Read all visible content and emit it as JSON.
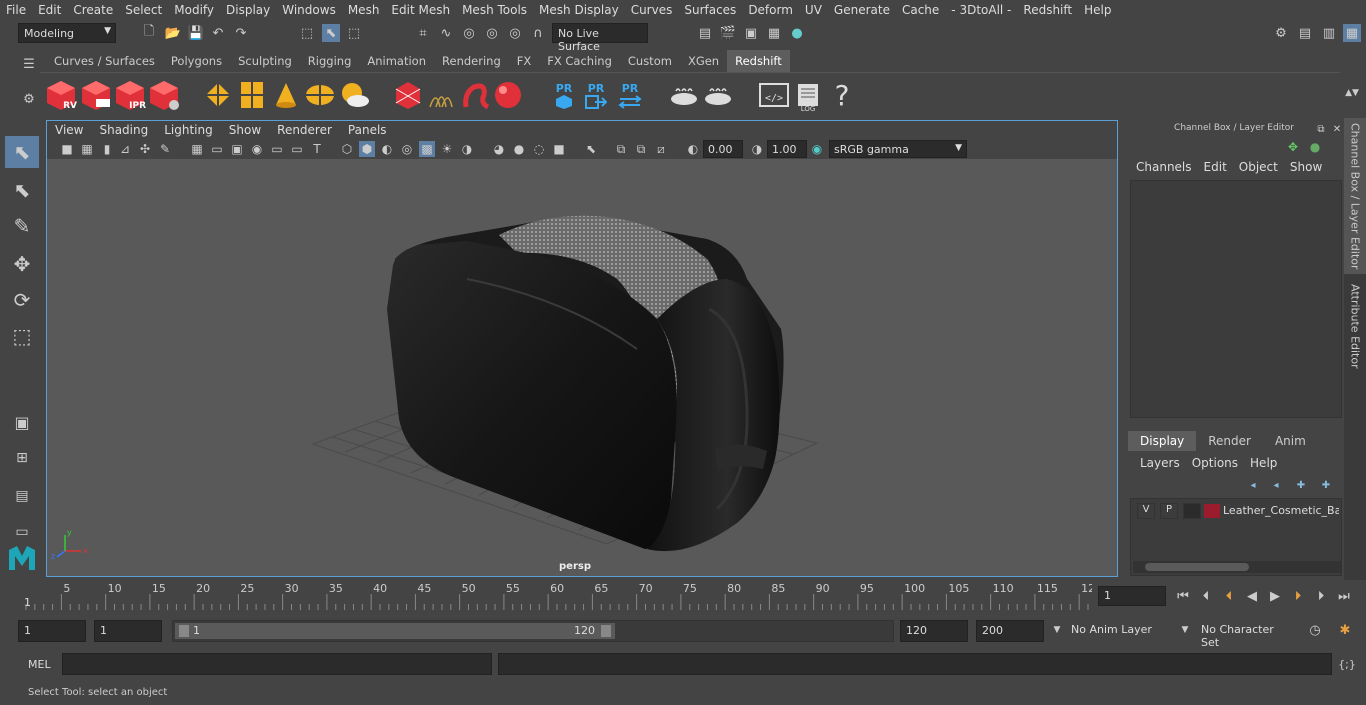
{
  "menubar": [
    "File",
    "Edit",
    "Create",
    "Select",
    "Modify",
    "Display",
    "Windows",
    "Mesh",
    "Edit Mesh",
    "Mesh Tools",
    "Mesh Display",
    "Curves",
    "Surfaces",
    "Deform",
    "UV",
    "Generate",
    "Cache",
    "- 3DtoAll -",
    "Redshift",
    "Help"
  ],
  "status": {
    "workspace": "Modeling",
    "live_surface": "No Live Surface"
  },
  "shelf": {
    "tabs": [
      "Curves / Surfaces",
      "Polygons",
      "Sculpting",
      "Rigging",
      "Animation",
      "Rendering",
      "FX",
      "FX Caching",
      "Custom",
      "XGen",
      "Redshift"
    ],
    "active_tab": "Redshift",
    "icons": {
      "rv": "RV",
      "ipr": "IPR",
      "pr1": "PR",
      "pr2": "PR",
      "pr3": "PR",
      "log": "LOG",
      "help": "?"
    }
  },
  "viewport": {
    "menu": [
      "View",
      "Shading",
      "Lighting",
      "Show",
      "Renderer",
      "Panels"
    ],
    "exposure": "0.00",
    "gamma": "1.00",
    "color_space": "sRGB gamma",
    "camera_label": "persp",
    "axis": {
      "x": "x",
      "y": "y",
      "z": "z"
    }
  },
  "channelbox": {
    "title": "Channel Box / Layer Editor",
    "menu": [
      "Channels",
      "Edit",
      "Object",
      "Show"
    ],
    "tabs": [
      "Display",
      "Render",
      "Anim"
    ],
    "active_tab": "Display",
    "layer_menu": [
      "Layers",
      "Options",
      "Help"
    ],
    "layers": [
      {
        "v": "V",
        "p": "P",
        "color": "#9b1c2c",
        "name": "Leather_Cosmetic_Bag"
      }
    ]
  },
  "sidetabs": [
    "Channel Box / Layer Editor",
    "Attribute Editor"
  ],
  "timeline": {
    "ticks": [
      "5",
      "10",
      "15",
      "20",
      "25",
      "30",
      "35",
      "40",
      "45",
      "50",
      "55",
      "60",
      "65",
      "70",
      "75",
      "80",
      "85",
      "90",
      "95",
      "100",
      "105",
      "110",
      "115",
      "12"
    ],
    "start_marker": "1",
    "current_frame": "1"
  },
  "range": {
    "start": "1",
    "playback_start": "1",
    "slider_start": "1",
    "slider_end": "120",
    "playback_end": "120",
    "end": "200",
    "anim_layer": "No Anim Layer",
    "character_set": "No Character Set"
  },
  "cmdline": {
    "label": "MEL"
  },
  "helpline": {
    "text": "Select Tool: select an object"
  }
}
